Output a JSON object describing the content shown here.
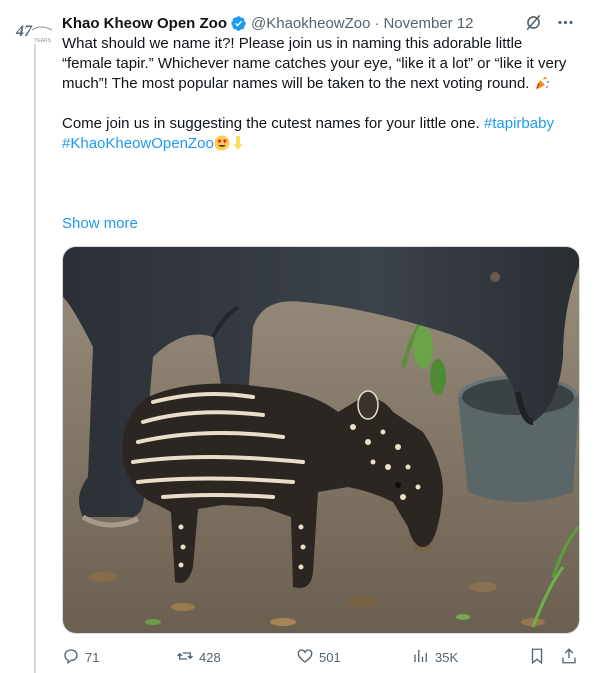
{
  "author": {
    "display_name": "Khao Kheow Open Zoo",
    "handle": "@KhaokheowZoo",
    "separator": "·",
    "date": "November 12",
    "verified": true,
    "avatar_text": "47",
    "avatar_subtext": "YEARS"
  },
  "tweet": {
    "paragraph1": "What should we name it?! Please join us in naming this adorable little “female tapir.” Whichever name catches your eye, “like it a lot” or “like it very much”! The most popular names will be taken to the next voting round.",
    "paragraph2_text": "Come join us in suggesting the cutest names for your little one.",
    "hashtag1": "#tapirbaby",
    "hashtag2": "#KhaoKheowOpenZoo",
    "emojis_p1": [
      "party-popper"
    ],
    "emojis_p2": [
      "heart-eyes",
      "pointing-down"
    ],
    "show_more": "Show more"
  },
  "media": {
    "alt": "Adult tapir eating from a bowl standing over a striped and spotted baby tapir"
  },
  "actions": {
    "replies": "71",
    "reposts": "428",
    "likes": "501",
    "views": "35K"
  },
  "colors": {
    "link": "#1d9bf0",
    "verified": "#1d9bf0",
    "secondary_text": "#536471",
    "primary_text": "#0f1419",
    "border": "#cfd9de"
  },
  "icons": [
    "grok-icon",
    "more-icon",
    "verified-icon",
    "reply-icon",
    "repost-icon",
    "like-icon",
    "views-icon",
    "bookmark-icon",
    "share-icon"
  ]
}
